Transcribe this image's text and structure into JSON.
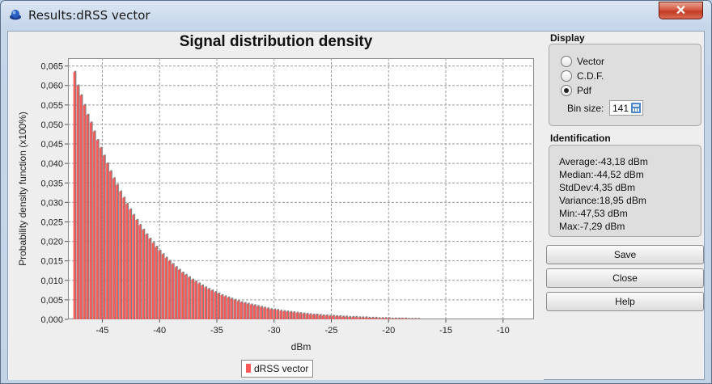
{
  "window": {
    "title": "Results:dRSS vector",
    "close_label": "✕"
  },
  "display": {
    "label": "Display",
    "options": [
      "Vector",
      "C.D.F.",
      "Pdf"
    ],
    "selected": "Pdf",
    "bin_size_label": "Bin size:",
    "bin_size_value": "141"
  },
  "identification": {
    "label": "Identification",
    "stats": [
      "Average:-43,18 dBm",
      "Median:-44,52 dBm",
      "StdDev:4,35 dBm",
      "Variance:18,95 dBm",
      "Min:-47,53 dBm",
      "Max:-7,29 dBm"
    ]
  },
  "buttons": {
    "save": "Save",
    "close": "Close",
    "help": "Help"
  },
  "chart_data": {
    "type": "bar",
    "title": "Signal distribution density",
    "xlabel": "dBm",
    "ylabel": "Probability density function (x100%)",
    "xlim": [
      -48.0,
      -7.3
    ],
    "ylim": [
      0,
      0.067
    ],
    "xticks": [
      -45,
      -40,
      -35,
      -30,
      -25,
      -20,
      -15,
      -10
    ],
    "xtick_labels": [
      "-45",
      "-40",
      "-35",
      "-30",
      "-25",
      "-20",
      "-15",
      "-10"
    ],
    "yticks": [
      0,
      0.005,
      0.01,
      0.015,
      0.02,
      0.025,
      0.03,
      0.035,
      0.04,
      0.045,
      0.05,
      0.055,
      0.06,
      0.065
    ],
    "ytick_labels": [
      "0,000",
      "0,005",
      "0,010",
      "0,015",
      "0,020",
      "0,025",
      "0,030",
      "0,035",
      "0,040",
      "0,045",
      "0,050",
      "0,055",
      "0,060",
      "0,065"
    ],
    "grid": true,
    "bar_color": "#ff5a5a",
    "bar_shadow_color": "#808080",
    "series": [
      {
        "name": "dRSS vector",
        "x": [
          -47.53,
          -47.24,
          -46.96,
          -46.67,
          -46.39,
          -46.1,
          -45.82,
          -45.53,
          -45.24,
          -44.96,
          -44.67,
          -44.39,
          -44.1,
          -43.82,
          -43.53,
          -43.24,
          -42.96,
          -42.67,
          -42.39,
          -42.1,
          -41.82,
          -41.53,
          -41.24,
          -40.96,
          -40.67,
          -40.39,
          -40.1,
          -39.82,
          -39.53,
          -39.24,
          -38.96,
          -38.67,
          -38.39,
          -38.1,
          -37.82,
          -37.53,
          -37.24,
          -36.96,
          -36.67,
          -36.39,
          -36.1,
          -35.82,
          -35.53,
          -35.24,
          -34.96,
          -34.67,
          -34.39,
          -34.1,
          -33.82,
          -33.53,
          -33.24,
          -32.96,
          -32.67,
          -32.39,
          -32.1,
          -31.82,
          -31.53,
          -31.24,
          -30.96,
          -30.67,
          -30.39,
          -30.1,
          -29.82,
          -29.53,
          -29.24,
          -28.96,
          -28.67,
          -28.39,
          -28.1,
          -27.82,
          -27.53,
          -27.24,
          -26.96,
          -26.67,
          -26.39,
          -26.1,
          -25.82,
          -25.53,
          -25.24,
          -24.96,
          -24.67,
          -24.39,
          -24.1,
          -23.82,
          -23.53,
          -23.24,
          -22.96,
          -22.67,
          -22.39,
          -22.1,
          -21.82,
          -21.53,
          -21.24,
          -20.96,
          -20.67,
          -20.39,
          -20.1,
          -19.82,
          -19.53,
          -19.24,
          -18.96,
          -18.67,
          -18.39,
          -18.1,
          -17.82,
          -17.53
        ],
        "values": [
          0.0635,
          0.06,
          0.0575,
          0.055,
          0.0525,
          0.0505,
          0.0482,
          0.046,
          0.044,
          0.042,
          0.04,
          0.038,
          0.0362,
          0.0345,
          0.0328,
          0.0312,
          0.0296,
          0.0282,
          0.0268,
          0.0255,
          0.0242,
          0.023,
          0.0218,
          0.0207,
          0.0196,
          0.0186,
          0.0176,
          0.0167,
          0.0158,
          0.015,
          0.0142,
          0.0134,
          0.0127,
          0.012,
          0.0114,
          0.0108,
          0.0102,
          0.0097,
          0.0092,
          0.0087,
          0.0082,
          0.0078,
          0.0074,
          0.007,
          0.0066,
          0.0062,
          0.0059,
          0.0056,
          0.0053,
          0.005,
          0.0047,
          0.0044,
          0.0042,
          0.004,
          0.0038,
          0.0036,
          0.0034,
          0.0032,
          0.003,
          0.0028,
          0.0026,
          0.0025,
          0.0024,
          0.0022,
          0.0021,
          0.002,
          0.0019,
          0.0018,
          0.0017,
          0.0016,
          0.0015,
          0.0014,
          0.0013,
          0.0012,
          0.0012,
          0.0011,
          0.001,
          0.001,
          0.0009,
          0.0009,
          0.0008,
          0.0008,
          0.0007,
          0.0007,
          0.0006,
          0.0006,
          0.0006,
          0.0005,
          0.0005,
          0.0005,
          0.0004,
          0.0004,
          0.0004,
          0.0003,
          0.0003,
          0.0003,
          0.0003,
          0.0002,
          0.0002,
          0.0002,
          0.0002,
          0.0002,
          0.0001,
          0.0001,
          0.0001,
          0.0001
        ]
      }
    ],
    "legend": "bottom-center"
  }
}
